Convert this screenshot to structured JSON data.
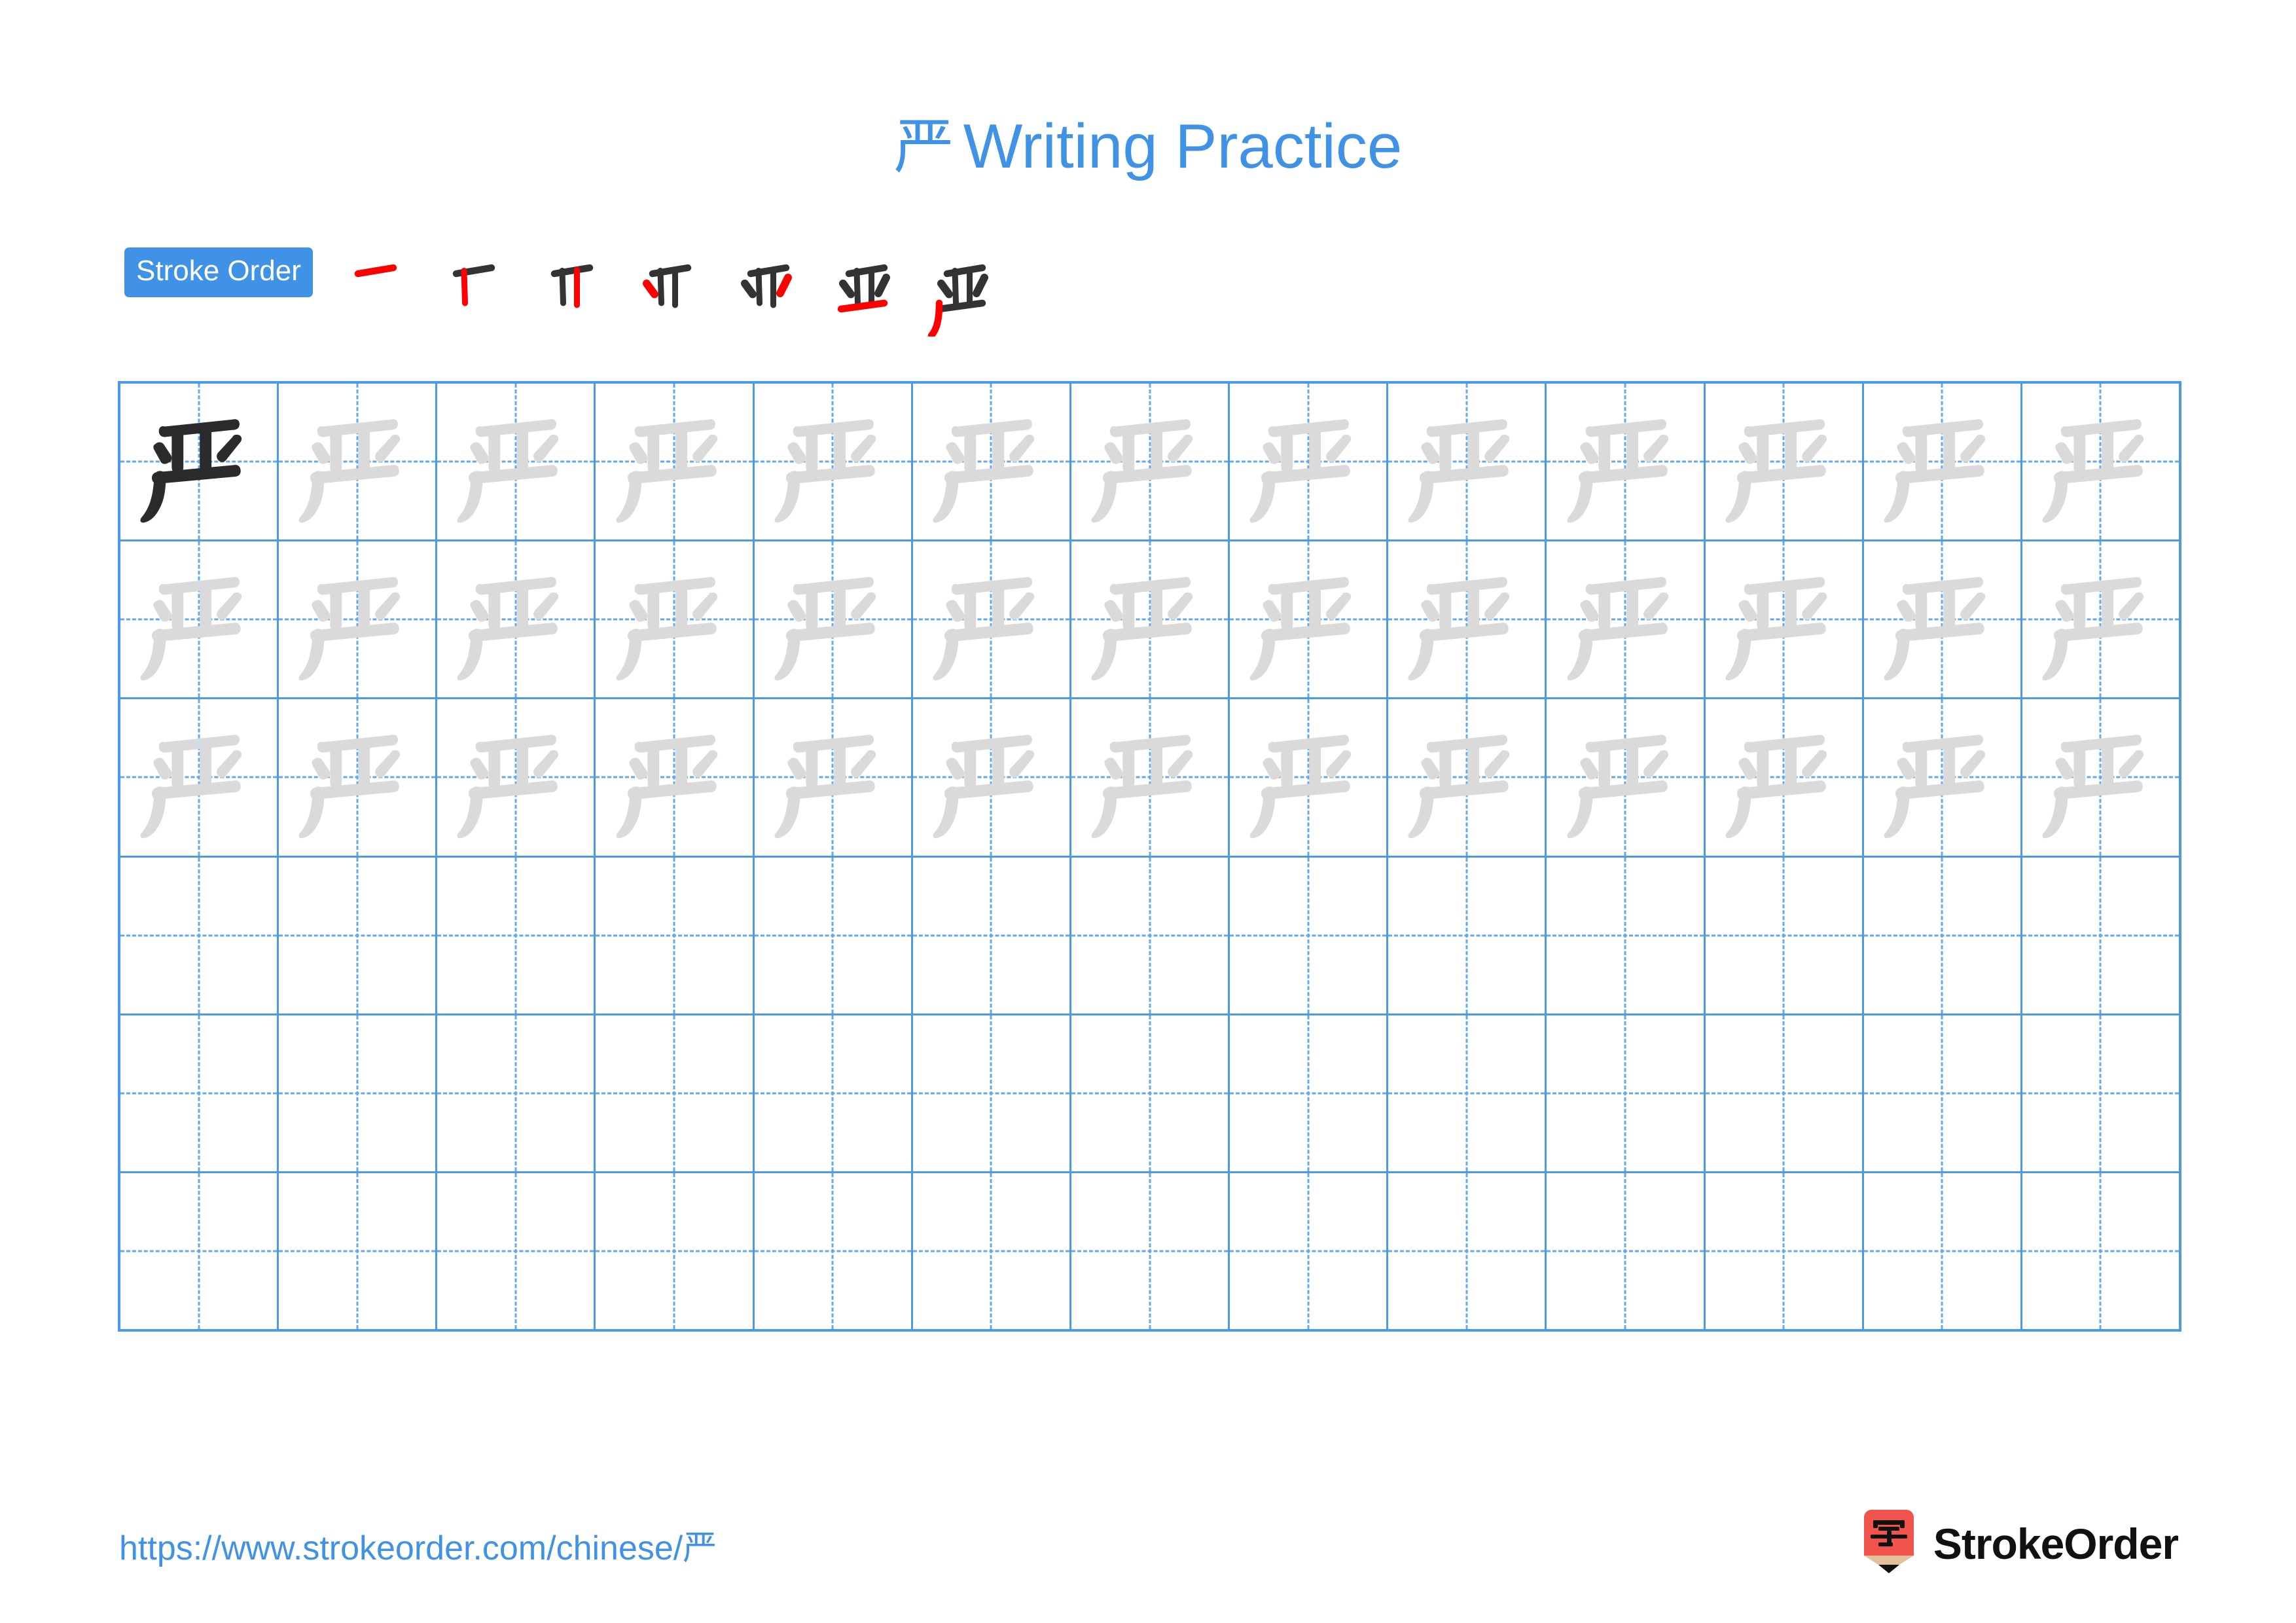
{
  "character": "严",
  "title": {
    "char": "严",
    "text": "Writing Practice",
    "color": "#3f92e5"
  },
  "stroke_order": {
    "badge_label": "Stroke Order",
    "badge_bg": "#3f92e5",
    "badge_text_color": "#ffffff",
    "new_stroke_color": "#ff0000",
    "prev_stroke_color": "#333333",
    "step_count": 7,
    "steps": [
      {
        "index": 1,
        "strokes_shown": 1,
        "new_stroke": "horizontal-top"
      },
      {
        "index": 2,
        "strokes_shown": 2,
        "new_stroke": "vertical-left"
      },
      {
        "index": 3,
        "strokes_shown": 3,
        "new_stroke": "vertical-right"
      },
      {
        "index": 4,
        "strokes_shown": 4,
        "new_stroke": "dot-left"
      },
      {
        "index": 5,
        "strokes_shown": 5,
        "new_stroke": "dot-right"
      },
      {
        "index": 6,
        "strokes_shown": 6,
        "new_stroke": "horizontal-bottom"
      },
      {
        "index": 7,
        "strokes_shown": 7,
        "new_stroke": "left-sweep"
      }
    ]
  },
  "grid": {
    "columns": 13,
    "rows": 6,
    "line_color": "#4a9ae8",
    "guide_color": "#63a9ec",
    "dark_char_color": "#2b2b2b",
    "trace_char_color": "#dadada",
    "row_fill": [
      {
        "row": 1,
        "mode": "first-dark-rest-trace"
      },
      {
        "row": 2,
        "mode": "all-trace"
      },
      {
        "row": 3,
        "mode": "all-trace"
      },
      {
        "row": 4,
        "mode": "empty"
      },
      {
        "row": 5,
        "mode": "empty"
      },
      {
        "row": 6,
        "mode": "empty"
      }
    ]
  },
  "footer": {
    "url": "https://www.strokeorder.com/chinese/严",
    "url_color": "#3f92e5",
    "brand_name": "StrokeOrder",
    "logo": {
      "icon_name": "pencil-zi-logo",
      "body_color": "#f0544c",
      "glyph": "字",
      "glyph_color": "#111111",
      "wood_color": "#e0c19a",
      "tip_color": "#111111"
    }
  }
}
